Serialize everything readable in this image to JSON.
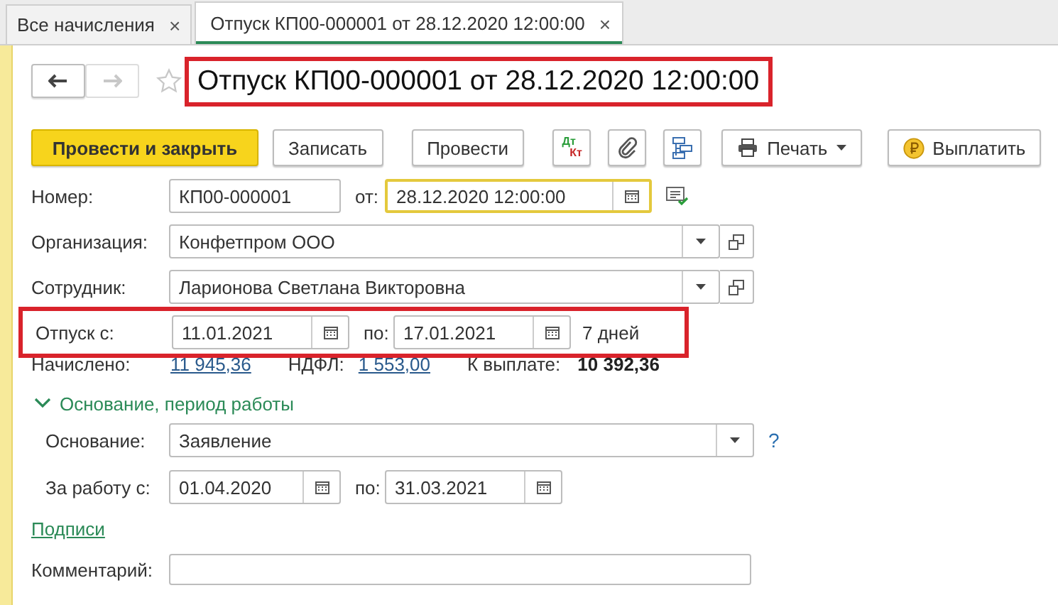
{
  "tabs": [
    {
      "label": "Все начисления",
      "selected": false,
      "close": "×"
    },
    {
      "label": "Отпуск КП00-000001 от 28.12.2020 12:00:00",
      "selected": true,
      "close": "×"
    }
  ],
  "nav": {
    "back_disabled": false,
    "forward_disabled": true,
    "favorite": false
  },
  "title": {
    "text": "Отпуск КП00-000001 от 28.12.2020 12:00:00",
    "highlighted": true
  },
  "toolbar": [
    {
      "kind": "primary",
      "label": "Провести и закрыть"
    },
    {
      "kind": "button",
      "label": "Записать"
    },
    {
      "kind": "button",
      "label": "Провести"
    },
    {
      "kind": "dtkt",
      "label": "Дт",
      "label2": "Кт"
    },
    {
      "kind": "attach"
    },
    {
      "kind": "structure"
    },
    {
      "kind": "menu",
      "label": "Печать"
    },
    {
      "kind": "pay",
      "label": "Выплатить"
    }
  ],
  "number": {
    "label": "Номер:",
    "value": "КП00-000001",
    "date_label": "от:",
    "date": "28.12.2020 12:00:00",
    "date_focused": true
  },
  "organization": {
    "label": "Организация:",
    "value": "Конфетпром ООО"
  },
  "employee": {
    "label": "Сотрудник:",
    "value": "Ларионова Светлана Викторовна"
  },
  "vacation": {
    "label": "Отпуск с:",
    "from": "11.01.2021",
    "to_label": "по:",
    "to": "17.01.2021",
    "days": "7 дней",
    "highlighted": true
  },
  "totals": [
    {
      "label": "Начислено:",
      "value": "11 945,36",
      "kind": "link"
    },
    {
      "label": "НДФЛ:",
      "value": "1 553,00",
      "kind": "link"
    },
    {
      "label": "К выплате:",
      "value": "10 392,36",
      "kind": "bold"
    }
  ],
  "group": {
    "title": "Основание, период работы",
    "expanded": true,
    "basis": {
      "label": "Основание:",
      "value": "Заявление",
      "help": "?"
    },
    "period": {
      "label": "За работу с:",
      "from": "01.04.2020",
      "to_label": "по:",
      "to": "31.03.2021"
    }
  },
  "signatures_link": "Подписи",
  "comment": {
    "label": "Комментарий:"
  }
}
